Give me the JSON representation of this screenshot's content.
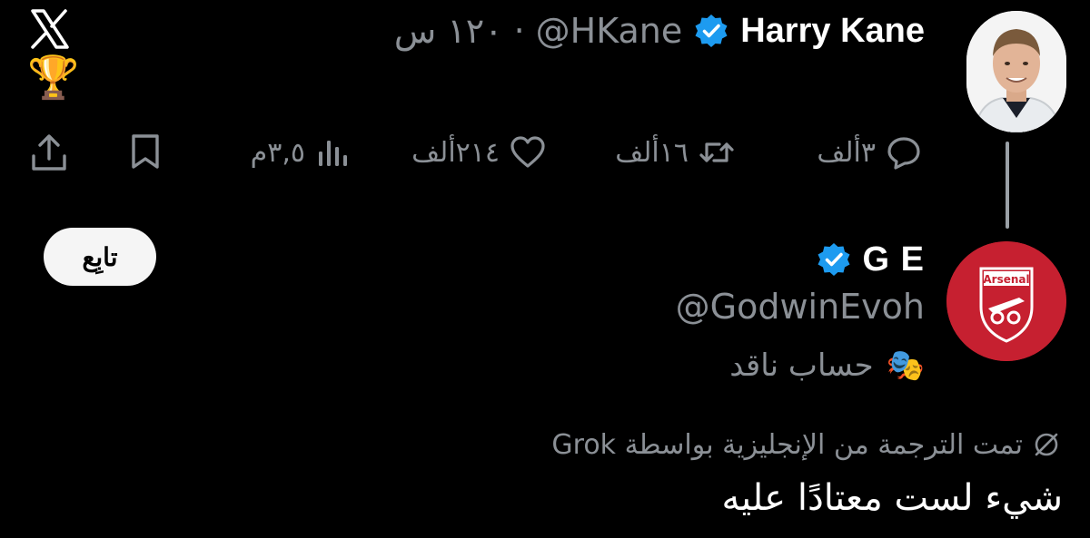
{
  "top_tweet": {
    "author_name": "Harry Kane",
    "handle": "@HKane",
    "separator": "·",
    "time": "١٢٠ س",
    "emoji": "🏆",
    "actions": {
      "reply_count": "٣ألف",
      "retweet_count": "١٦ألف",
      "like_count": "٢١٤ألف",
      "views_count": "٣,٥م"
    }
  },
  "reply_profile": {
    "name": "G E",
    "handle": "@GodwinEvoh",
    "parody_label": "حساب ناقد",
    "parody_emoji": "🎭",
    "follow_label": "تابِع",
    "avatar_badge_text": "Arsenal"
  },
  "translation": {
    "label": "تمت الترجمة من الإنجليزية بواسطة Grok"
  },
  "reply_text": "شيء لست معتادًا عليه",
  "colors": {
    "background": "#000000",
    "verified_blue": "#1d9bf0",
    "muted_text": "#8b9096",
    "arsenal_red": "#c62030"
  }
}
